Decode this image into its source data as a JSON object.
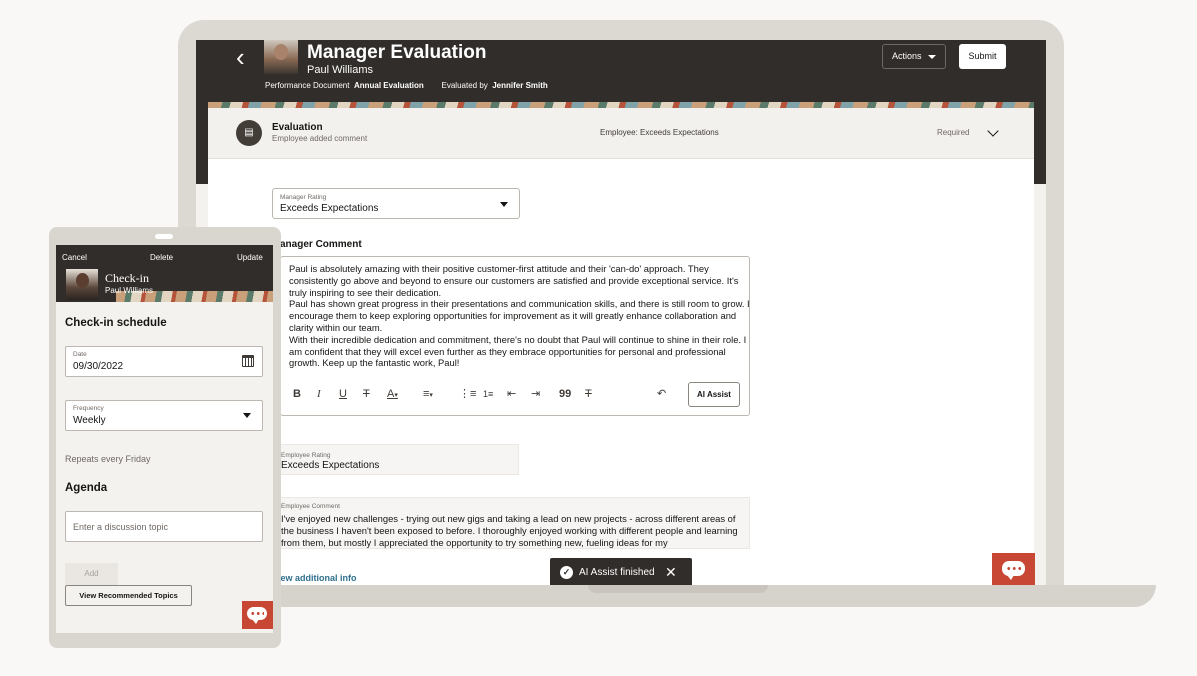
{
  "laptop": {
    "header": {
      "title": "Manager Evaluation",
      "subtitle": "Paul Williams",
      "doc_label": "Performance Document",
      "doc_value": "Annual Evaluation",
      "evaluated_label": "Evaluated by",
      "evaluated_value": "Jennifer Smith",
      "actions_label": "Actions",
      "submit_label": "Submit"
    },
    "section": {
      "title": "Evaluation",
      "subtitle": "Employee added comment",
      "employee_status": "Employee: Exceeds Expectations",
      "required": "Required"
    },
    "manager_rating": {
      "label": "Manager Rating",
      "value": "Exceeds Expectations"
    },
    "manager_comment": {
      "label": "anager Comment",
      "paragraphs": [
        "Paul is absolutely amazing with their positive customer-first attitude and their 'can-do' approach. They consistently go above and beyond to ensure our customers are satisfied and provide exceptional service. It's truly inspiring to see their dedication.",
        "Paul has shown great progress in their presentations and communication skills, and there is still room to grow. I encourage them to keep exploring opportunities for improvement as it will greatly enhance collaboration and clarity within our team.",
        "With their incredible dedication and commitment, there's no doubt that Paul will continue to shine in their role. I am confident that they will excel even further as they embrace opportunities for personal and professional growth. Keep up the fantastic work, Paul!"
      ],
      "ai_assist_label": "AI Assist"
    },
    "employee_rating": {
      "label": "Employee Rating",
      "value": "Exceeds Expectations"
    },
    "employee_comment": {
      "label": "Employee Comment",
      "text": "I've enjoyed new challenges - trying out new gigs and taking a lead on new projects - across different areas of the business I haven't been exposed to before. I thoroughly enjoyed working with different people and learning from them, but mostly I appreciated the opportunity to try something new, fueling ideas for my"
    },
    "view_more_link": "iew additional info",
    "toast": {
      "message": "AI Assist finished",
      "close": "✕"
    }
  },
  "phone": {
    "cancel": "Cancel",
    "delete": "Delete",
    "update": "Update",
    "title": "Check-in",
    "name": "Paul Williams",
    "schedule_heading": "Check-in schedule",
    "date": {
      "label": "Date",
      "value": "09/30/2022"
    },
    "frequency": {
      "label": "Frequency",
      "value": "Weekly"
    },
    "repeats_text": "Repeats every Friday",
    "agenda_heading": "Agenda",
    "topic_placeholder": "Enter a discussion topic",
    "add_label": "Add",
    "view_topics_label": "View Recommended Topics"
  },
  "icons": {
    "back": "chevron-left-icon",
    "section": "document-icon",
    "chat": "chat-bubble-icon",
    "calendar": "calendar-icon"
  },
  "colors": {
    "header": "#312d2a",
    "accent_chat": "#c74634",
    "link": "#2f6f8f"
  }
}
